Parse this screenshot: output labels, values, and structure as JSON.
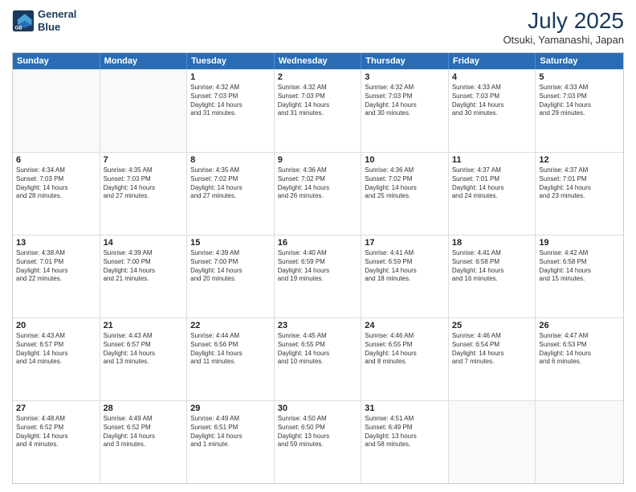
{
  "logo": {
    "line1": "General",
    "line2": "Blue"
  },
  "title": "July 2025",
  "location": "Otsuki, Yamanashi, Japan",
  "header_days": [
    "Sunday",
    "Monday",
    "Tuesday",
    "Wednesday",
    "Thursday",
    "Friday",
    "Saturday"
  ],
  "rows": [
    [
      {
        "day": "",
        "info": [],
        "empty": true
      },
      {
        "day": "",
        "info": [],
        "empty": true
      },
      {
        "day": "1",
        "info": [
          "Sunrise: 4:32 AM",
          "Sunset: 7:03 PM",
          "Daylight: 14 hours",
          "and 31 minutes."
        ]
      },
      {
        "day": "2",
        "info": [
          "Sunrise: 4:32 AM",
          "Sunset: 7:03 PM",
          "Daylight: 14 hours",
          "and 31 minutes."
        ]
      },
      {
        "day": "3",
        "info": [
          "Sunrise: 4:32 AM",
          "Sunset: 7:03 PM",
          "Daylight: 14 hours",
          "and 30 minutes."
        ]
      },
      {
        "day": "4",
        "info": [
          "Sunrise: 4:33 AM",
          "Sunset: 7:03 PM",
          "Daylight: 14 hours",
          "and 30 minutes."
        ]
      },
      {
        "day": "5",
        "info": [
          "Sunrise: 4:33 AM",
          "Sunset: 7:03 PM",
          "Daylight: 14 hours",
          "and 29 minutes."
        ]
      }
    ],
    [
      {
        "day": "6",
        "info": [
          "Sunrise: 4:34 AM",
          "Sunset: 7:03 PM",
          "Daylight: 14 hours",
          "and 28 minutes."
        ]
      },
      {
        "day": "7",
        "info": [
          "Sunrise: 4:35 AM",
          "Sunset: 7:03 PM",
          "Daylight: 14 hours",
          "and 27 minutes."
        ]
      },
      {
        "day": "8",
        "info": [
          "Sunrise: 4:35 AM",
          "Sunset: 7:02 PM",
          "Daylight: 14 hours",
          "and 27 minutes."
        ]
      },
      {
        "day": "9",
        "info": [
          "Sunrise: 4:36 AM",
          "Sunset: 7:02 PM",
          "Daylight: 14 hours",
          "and 26 minutes."
        ]
      },
      {
        "day": "10",
        "info": [
          "Sunrise: 4:36 AM",
          "Sunset: 7:02 PM",
          "Daylight: 14 hours",
          "and 25 minutes."
        ]
      },
      {
        "day": "11",
        "info": [
          "Sunrise: 4:37 AM",
          "Sunset: 7:01 PM",
          "Daylight: 14 hours",
          "and 24 minutes."
        ]
      },
      {
        "day": "12",
        "info": [
          "Sunrise: 4:37 AM",
          "Sunset: 7:01 PM",
          "Daylight: 14 hours",
          "and 23 minutes."
        ]
      }
    ],
    [
      {
        "day": "13",
        "info": [
          "Sunrise: 4:38 AM",
          "Sunset: 7:01 PM",
          "Daylight: 14 hours",
          "and 22 minutes."
        ]
      },
      {
        "day": "14",
        "info": [
          "Sunrise: 4:39 AM",
          "Sunset: 7:00 PM",
          "Daylight: 14 hours",
          "and 21 minutes."
        ]
      },
      {
        "day": "15",
        "info": [
          "Sunrise: 4:39 AM",
          "Sunset: 7:00 PM",
          "Daylight: 14 hours",
          "and 20 minutes."
        ]
      },
      {
        "day": "16",
        "info": [
          "Sunrise: 4:40 AM",
          "Sunset: 6:59 PM",
          "Daylight: 14 hours",
          "and 19 minutes."
        ]
      },
      {
        "day": "17",
        "info": [
          "Sunrise: 4:41 AM",
          "Sunset: 6:59 PM",
          "Daylight: 14 hours",
          "and 18 minutes."
        ]
      },
      {
        "day": "18",
        "info": [
          "Sunrise: 4:41 AM",
          "Sunset: 6:58 PM",
          "Daylight: 14 hours",
          "and 16 minutes."
        ]
      },
      {
        "day": "19",
        "info": [
          "Sunrise: 4:42 AM",
          "Sunset: 6:58 PM",
          "Daylight: 14 hours",
          "and 15 minutes."
        ]
      }
    ],
    [
      {
        "day": "20",
        "info": [
          "Sunrise: 4:43 AM",
          "Sunset: 6:57 PM",
          "Daylight: 14 hours",
          "and 14 minutes."
        ]
      },
      {
        "day": "21",
        "info": [
          "Sunrise: 4:43 AM",
          "Sunset: 6:57 PM",
          "Daylight: 14 hours",
          "and 13 minutes."
        ]
      },
      {
        "day": "22",
        "info": [
          "Sunrise: 4:44 AM",
          "Sunset: 6:56 PM",
          "Daylight: 14 hours",
          "and 11 minutes."
        ]
      },
      {
        "day": "23",
        "info": [
          "Sunrise: 4:45 AM",
          "Sunset: 6:55 PM",
          "Daylight: 14 hours",
          "and 10 minutes."
        ]
      },
      {
        "day": "24",
        "info": [
          "Sunrise: 4:46 AM",
          "Sunset: 6:55 PM",
          "Daylight: 14 hours",
          "and 8 minutes."
        ]
      },
      {
        "day": "25",
        "info": [
          "Sunrise: 4:46 AM",
          "Sunset: 6:54 PM",
          "Daylight: 14 hours",
          "and 7 minutes."
        ]
      },
      {
        "day": "26",
        "info": [
          "Sunrise: 4:47 AM",
          "Sunset: 6:53 PM",
          "Daylight: 14 hours",
          "and 6 minutes."
        ]
      }
    ],
    [
      {
        "day": "27",
        "info": [
          "Sunrise: 4:48 AM",
          "Sunset: 6:52 PM",
          "Daylight: 14 hours",
          "and 4 minutes."
        ]
      },
      {
        "day": "28",
        "info": [
          "Sunrise: 4:49 AM",
          "Sunset: 6:52 PM",
          "Daylight: 14 hours",
          "and 3 minutes."
        ]
      },
      {
        "day": "29",
        "info": [
          "Sunrise: 4:49 AM",
          "Sunset: 6:51 PM",
          "Daylight: 14 hours",
          "and 1 minute."
        ]
      },
      {
        "day": "30",
        "info": [
          "Sunrise: 4:50 AM",
          "Sunset: 6:50 PM",
          "Daylight: 13 hours",
          "and 59 minutes."
        ]
      },
      {
        "day": "31",
        "info": [
          "Sunrise: 4:51 AM",
          "Sunset: 6:49 PM",
          "Daylight: 13 hours",
          "and 58 minutes."
        ]
      },
      {
        "day": "",
        "info": [],
        "empty": true
      },
      {
        "day": "",
        "info": [],
        "empty": true
      }
    ]
  ]
}
